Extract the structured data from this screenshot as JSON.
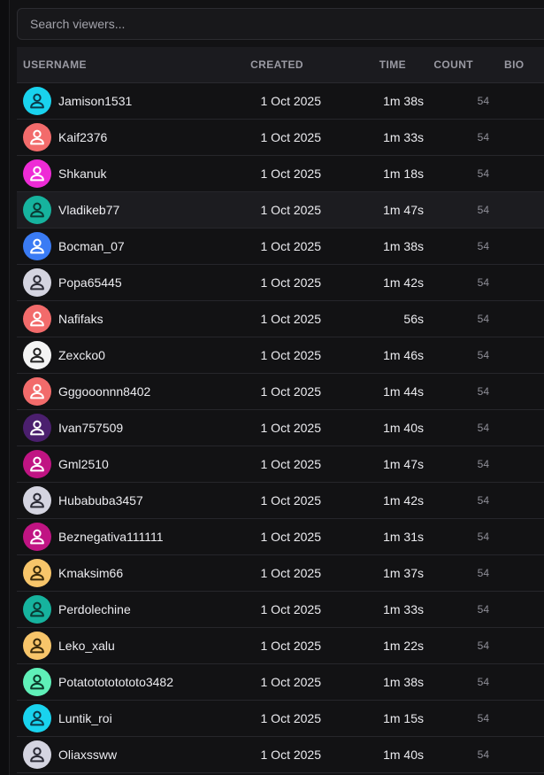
{
  "search": {
    "placeholder": "Search viewers..."
  },
  "table": {
    "headers": {
      "username": "USERNAME",
      "created": "CREATED",
      "time": "TIME",
      "count": "COUNT",
      "bio": "BIO"
    },
    "rows": [
      {
        "username": "Jamison1531",
        "created": "1 Oct 2025",
        "time": "1m 38s",
        "count": "54",
        "avatar_bg": "#19d3ee",
        "icon_color": "#0b3a4a"
      },
      {
        "username": "Kaif2376",
        "created": "1 Oct 2025",
        "time": "1m 33s",
        "count": "54",
        "avatar_bg": "#f26b6b",
        "icon_color": "#ffffff"
      },
      {
        "username": "Shkanuk",
        "created": "1 Oct 2025",
        "time": "1m 18s",
        "count": "54",
        "avatar_bg": "#ee2bd6",
        "icon_color": "#ffffff"
      },
      {
        "username": "Vladikeb77",
        "created": "1 Oct 2025",
        "time": "1m 47s",
        "count": "54",
        "avatar_bg": "#16b39e",
        "icon_color": "#0b3a34"
      },
      {
        "username": "Bocman_07",
        "created": "1 Oct 2025",
        "time": "1m 38s",
        "count": "54",
        "avatar_bg": "#3a7bf4",
        "icon_color": "#ffffff"
      },
      {
        "username": "Popa65445",
        "created": "1 Oct 2025",
        "time": "1m 42s",
        "count": "54",
        "avatar_bg": "#d4d4e0",
        "icon_color": "#2a2a35"
      },
      {
        "username": "Nafifaks",
        "created": "1 Oct 2025",
        "time": "56s",
        "count": "54",
        "avatar_bg": "#f26b6b",
        "icon_color": "#ffffff"
      },
      {
        "username": "Zexcko0",
        "created": "1 Oct 2025",
        "time": "1m 46s",
        "count": "54",
        "avatar_bg": "#f4f4f4",
        "icon_color": "#222222"
      },
      {
        "username": "Gggooonnn8402",
        "created": "1 Oct 2025",
        "time": "1m 44s",
        "count": "54",
        "avatar_bg": "#f26b6b",
        "icon_color": "#ffffff"
      },
      {
        "username": "Ivan757509",
        "created": "1 Oct 2025",
        "time": "1m 40s",
        "count": "54",
        "avatar_bg": "#4b1f6e",
        "icon_color": "#ffffff"
      },
      {
        "username": "Gml2510",
        "created": "1 Oct 2025",
        "time": "1m 47s",
        "count": "54",
        "avatar_bg": "#c01483",
        "icon_color": "#ffffff"
      },
      {
        "username": "Hubabuba3457",
        "created": "1 Oct 2025",
        "time": "1m 42s",
        "count": "54",
        "avatar_bg": "#d4d4e0",
        "icon_color": "#2a2a35"
      },
      {
        "username": "Beznegativa111111",
        "created": "1 Oct 2025",
        "time": "1m 31s",
        "count": "54",
        "avatar_bg": "#c01483",
        "icon_color": "#ffffff"
      },
      {
        "username": "Kmaksim66",
        "created": "1 Oct 2025",
        "time": "1m 37s",
        "count": "54",
        "avatar_bg": "#f7c56a",
        "icon_color": "#3a2a0a"
      },
      {
        "username": "Perdolechine",
        "created": "1 Oct 2025",
        "time": "1m 33s",
        "count": "54",
        "avatar_bg": "#16b39e",
        "icon_color": "#0b3a34"
      },
      {
        "username": "Leko_xalu",
        "created": "1 Oct 2025",
        "time": "1m 22s",
        "count": "54",
        "avatar_bg": "#f7c56a",
        "icon_color": "#3a2a0a"
      },
      {
        "username": "Potatotototototo3482",
        "created": "1 Oct 2025",
        "time": "1m 38s",
        "count": "54",
        "avatar_bg": "#5ff0b8",
        "icon_color": "#0b3a2a"
      },
      {
        "username": "Luntik_roi",
        "created": "1 Oct 2025",
        "time": "1m 15s",
        "count": "54",
        "avatar_bg": "#19d3ee",
        "icon_color": "#0b3a4a"
      },
      {
        "username": "Oliaxssww",
        "created": "1 Oct 2025",
        "time": "1m 40s",
        "count": "54",
        "avatar_bg": "#d4d4e0",
        "icon_color": "#2a2a35"
      }
    ]
  }
}
